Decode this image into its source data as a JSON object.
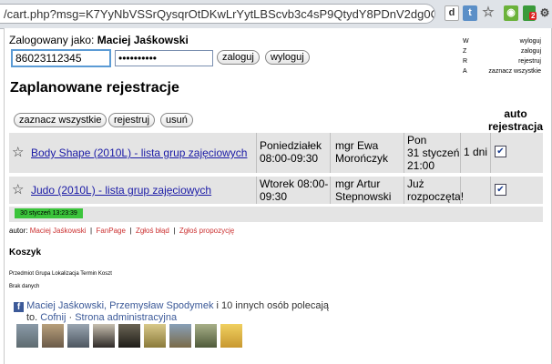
{
  "browser": {
    "url": "/cart.php?msg=K7YyNbVSSrQysqrOtDKwLrYytLBScvb3c4sP9QtydY8PDnV2dg0OVrLOtDIE...",
    "ext_badge": "2",
    "ext_icons": [
      "dictionary-icon",
      "t-icon",
      "bookmark-star-icon",
      "rss-icon",
      "extension-icon"
    ]
  },
  "login": {
    "label": "Zalogowany jako:",
    "user": "Maciej Jaśkowski",
    "login_value": "86023112345",
    "password_value": "••••••••••",
    "login_button": "zaloguj",
    "logout_button": "wyloguj"
  },
  "shortcuts": [
    {
      "key": "W",
      "action": "wyloguj"
    },
    {
      "key": "Z",
      "action": "zaloguj"
    },
    {
      "key": "R",
      "action": "rejestruj"
    },
    {
      "key": "A",
      "action": "zaznacz wszystkie"
    }
  ],
  "page_title": "Zaplanowane rejestracje",
  "toolbar": {
    "select_all": "zaznacz wszystkie",
    "register": "rejestruj",
    "delete": "usuń"
  },
  "auto_header": "auto rejestracja",
  "registrations": [
    {
      "course": "Body Shape (2010L) - lista grup zajęciowych",
      "time_day": "Poniedziałek",
      "time_hours": "08:00-09:30",
      "teacher_1": "mgr Ewa",
      "teacher_2": "Morończyk",
      "when_1": "Pon",
      "when_2": "31 styczeń",
      "when_3": "21:00",
      "remaining": "1 dni",
      "auto": true
    },
    {
      "course": "Judo (2010L) - lista grup zajęciowych",
      "time_day": "Wtorek 08:00-",
      "time_hours": "09:30",
      "teacher_1": "mgr Artur",
      "teacher_2": "Stepnowski",
      "when_1": "Już",
      "when_2": "rozpoczęta!",
      "when_3": "",
      "remaining": "",
      "auto": true
    }
  ],
  "status_time": "30 styczeń 13:23:39",
  "footer": {
    "author_label": "autor:",
    "author": "Maciej Jaśkowski",
    "links": [
      "FanPage",
      "Zgłoś błąd",
      "Zgłoś propozycję"
    ],
    "sep": "|"
  },
  "cart": {
    "title": "Koszyk",
    "columns": "Przedmiot Grupa Lokalizacja Termin Koszt",
    "empty": "Brak danych"
  },
  "facebook": {
    "names": "Maciej Jaśkowski, Przemysław Spodymek",
    "rest": " i 10 innych osób polecają",
    "line2_prefix": "to.",
    "undo": "Cofnij",
    "separator": " · ",
    "admin": "Strona administracyjna"
  },
  "colors": {
    "row_bg": "#e4e4e4",
    "status_green": "#3bc43b",
    "link_blue": "#1a1aa6",
    "footer_red": "#cc3333",
    "fb_blue": "#3b5998"
  }
}
